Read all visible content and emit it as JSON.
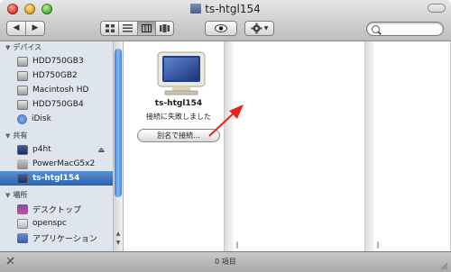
{
  "window": {
    "title": "ts-htgl154"
  },
  "toolbar": {
    "back": "◀",
    "forward": "▶"
  },
  "search": {
    "placeholder": ""
  },
  "sidebar": {
    "devices_label": "デバイス",
    "devices": [
      "HDD750GB3",
      "HD750GB2",
      "Macintosh HD",
      "HDD750GB4",
      "iDisk"
    ],
    "shared_label": "共有",
    "shared": [
      "p4ht",
      "PowerMacG5x2",
      "ts-htgl154"
    ],
    "places_label": "場所",
    "places": [
      "デスクトップ",
      "openspc",
      "アプリケーション"
    ]
  },
  "server": {
    "name": "ts-htgl154",
    "status": "接続に失敗しました",
    "connect_as_button": "別名で接続..."
  },
  "statusbar": {
    "text": "0 項目"
  },
  "colors": {
    "selection": "#2a63b0",
    "scroll_thumb": "#3f7ed8",
    "annotation_arrow": "#e8231b"
  },
  "icons": [
    "back-icon",
    "forward-icon",
    "icon-view-icon",
    "list-view-icon",
    "column-view-icon",
    "cover-flow-icon",
    "eye-icon",
    "gear-icon",
    "search-icon",
    "eject-icon",
    "pencil-icon",
    "resize-grip-icon"
  ]
}
